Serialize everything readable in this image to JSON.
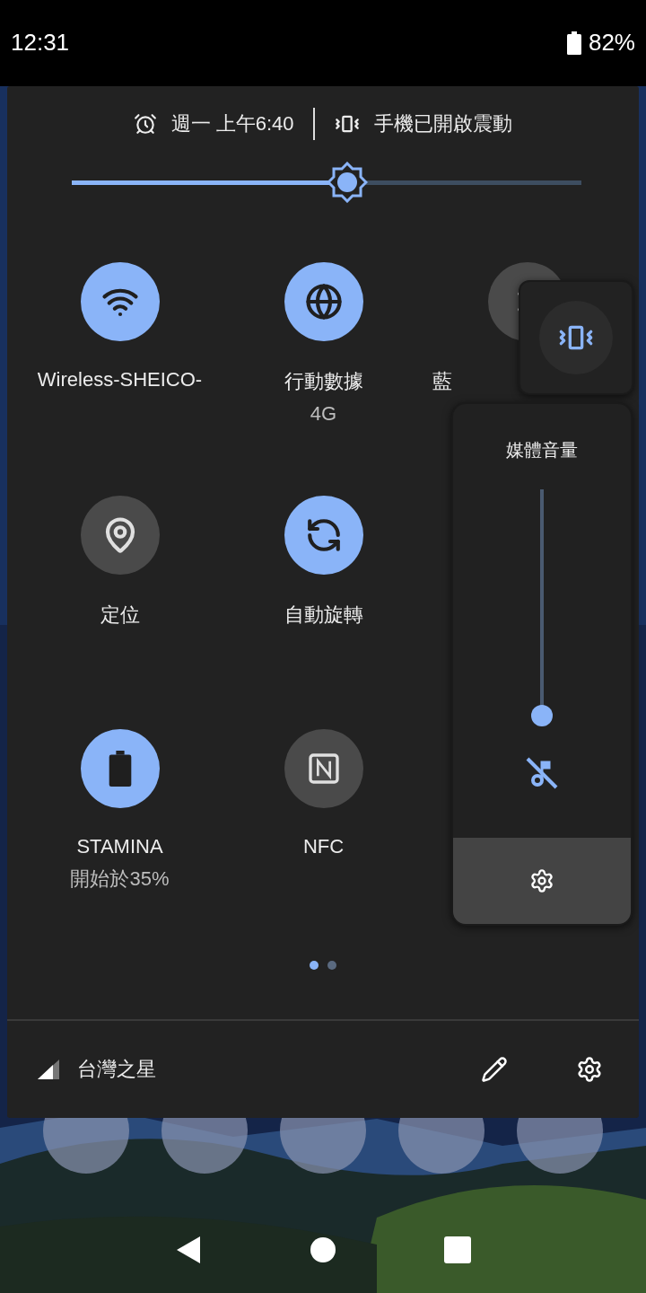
{
  "status_bar": {
    "time": "12:31",
    "battery": "82%"
  },
  "header": {
    "alarm": "週一 上午6:40",
    "ringer": "手機已開啟震動"
  },
  "brightness": {
    "level": 0.54
  },
  "tile_rows": [
    {
      "tiles": [
        {
          "label": "Wireless-SHEICO-",
          "on": true
        },
        {
          "label": "行動數據",
          "sublabel": "4G",
          "on": true
        },
        {
          "label": "藍",
          "on": false
        }
      ]
    },
    {
      "tiles": [
        {
          "label": "定位",
          "on": false
        },
        {
          "label": "自動旋轉",
          "on": true
        }
      ]
    },
    {
      "tiles": [
        {
          "label": "STAMINA",
          "sublabel": "開始於35%",
          "on": true
        },
        {
          "label": "NFC",
          "on": false
        }
      ]
    }
  ],
  "pages": [
    {
      "selected": true
    },
    {
      "selected": false
    }
  ],
  "footer": {
    "carrier": "台灣之星"
  },
  "volume_dialog": {
    "vibrate": true,
    "title": "媒體音量",
    "level": 0,
    "muted": true
  }
}
